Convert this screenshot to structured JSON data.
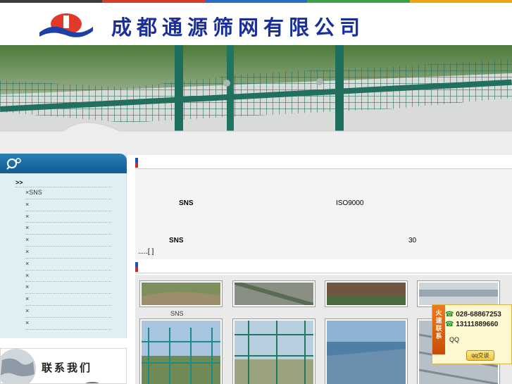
{
  "header": {
    "company_name": "成都通源筛网有限公司"
  },
  "sidebar": {
    "root_label": ">>",
    "items": [
      {
        "label": "SNS"
      },
      {
        "label": ""
      },
      {
        "label": ""
      },
      {
        "label": ""
      },
      {
        "label": ""
      },
      {
        "label": ""
      },
      {
        "label": ""
      },
      {
        "label": ""
      },
      {
        "label": ""
      },
      {
        "label": ""
      },
      {
        "label": ""
      },
      {
        "label": ""
      }
    ]
  },
  "contact": {
    "title": "联系我们"
  },
  "about": {
    "line1_a": "SNS",
    "line1_b": "ISO9000",
    "line2_a": "SNS",
    "line2_b": "30",
    "more": ".....[ ]"
  },
  "products": {
    "items": [
      {
        "label": "SNS"
      },
      {
        "label": ""
      },
      {
        "label": ""
      },
      {
        "label": ""
      }
    ]
  },
  "qq_widget": {
    "tab_text": "火速联系",
    "phone1": "028-68867253",
    "phone2": "13111889660",
    "qq_label": "QQ",
    "qq_button": "qq交谈"
  },
  "colors": {
    "brand_blue": "#1a2f9a",
    "sidebar_header": "#0f5c92",
    "sidebar_bg": "#dff0f5",
    "accent_red": "#d02828",
    "strip": [
      "#3c3c3c",
      "#d63a2a",
      "#2c6bc4",
      "#3aa14a",
      "#e9a514"
    ]
  }
}
